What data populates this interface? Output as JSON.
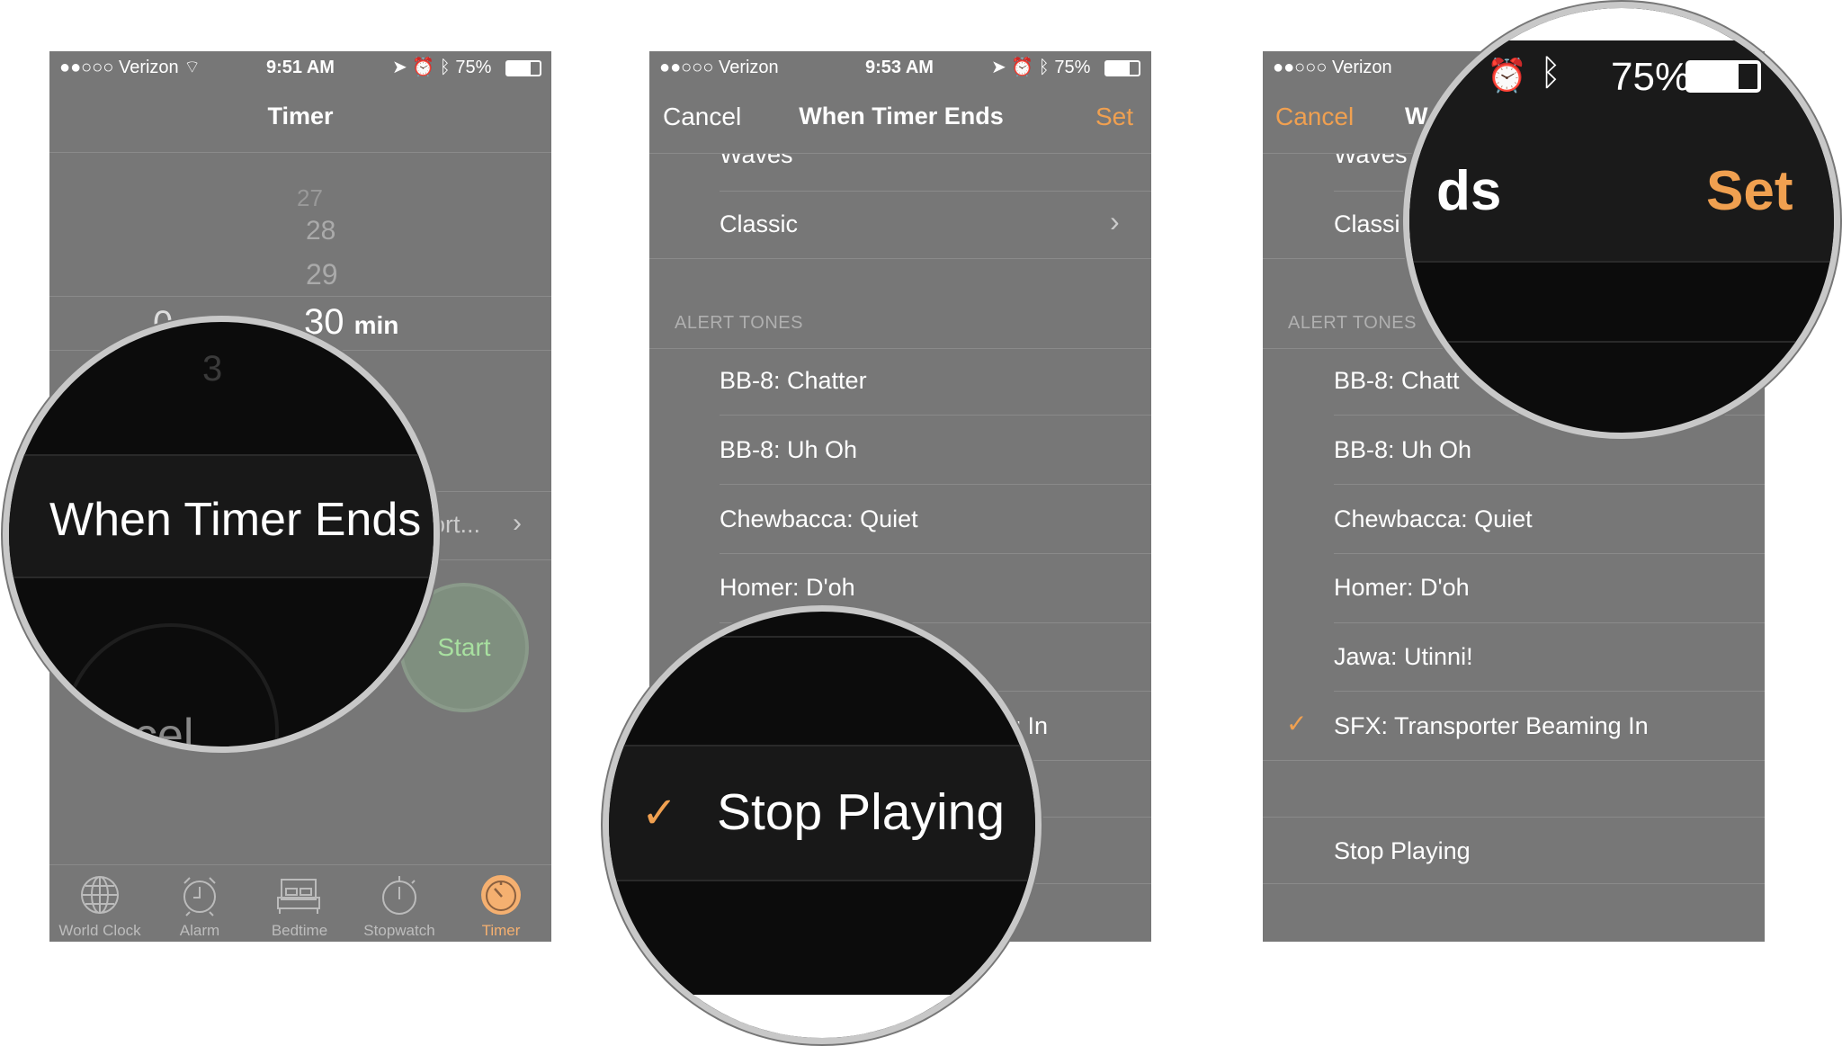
{
  "status_bar": {
    "carrier": "Verizon",
    "signal": "●●○○○",
    "battery": "75%",
    "times": [
      "9:51 AM",
      "9:53 AM"
    ]
  },
  "screen1": {
    "title": "Timer",
    "picker_minutes": [
      "27",
      "28",
      "29"
    ],
    "selected_minutes": "30",
    "minutes_unit": "min",
    "hours_partial": "0",
    "sound_value_partial": "ort...",
    "start_label": "Start",
    "magnifier": {
      "label": "When Timer Ends",
      "picker_next": "3",
      "cancel_partial": "ncel"
    },
    "tabs": [
      {
        "label": "World Clock",
        "icon": "globe-icon"
      },
      {
        "label": "Alarm",
        "icon": "alarm-clock-icon"
      },
      {
        "label": "Bedtime",
        "icon": "bed-icon"
      },
      {
        "label": "Stopwatch",
        "icon": "stopwatch-icon"
      },
      {
        "label": "Timer",
        "icon": "timer-icon",
        "active": true
      }
    ]
  },
  "screen2": {
    "cancel": "Cancel",
    "title": "When Timer Ends",
    "set": "Set",
    "partial_row": "Waves",
    "classic": "Classic",
    "section_header": "ALERT TONES",
    "tones": [
      "BB-8: Chatter",
      "BB-8: Uh Oh",
      "Chewbacca: Quiet",
      "Homer: D'oh",
      "Jawa: Utinni!",
      "SFX: Transporter Beaming In"
    ],
    "sfx_partial": "g In",
    "stop_playing": "Stop Playing",
    "selected": "Stop Playing"
  },
  "screen3": {
    "cancel": "Cancel",
    "title_partial": "W",
    "set": "Set",
    "partial_row": "Waves",
    "classic_partial": "Classi",
    "section_header": "ALERT TONES",
    "tones": [
      "BB-8: Chatter",
      "BB-8: Uh Oh",
      "Chewbacca: Quiet",
      "Homer: D'oh",
      "Jawa: Utinni!",
      "SFX: Transporter Beaming In"
    ],
    "chatter_partial": "BB-8: Chatt",
    "stop_playing": "Stop Playing",
    "selected": "SFX: Transporter Beaming In",
    "magnifier": {
      "title_partial": "ds",
      "set": "Set",
      "battery": "75%"
    }
  },
  "colors": {
    "accent": "#f0a050",
    "start_green": "#a8e0a0",
    "screen_bg": "#777777"
  }
}
